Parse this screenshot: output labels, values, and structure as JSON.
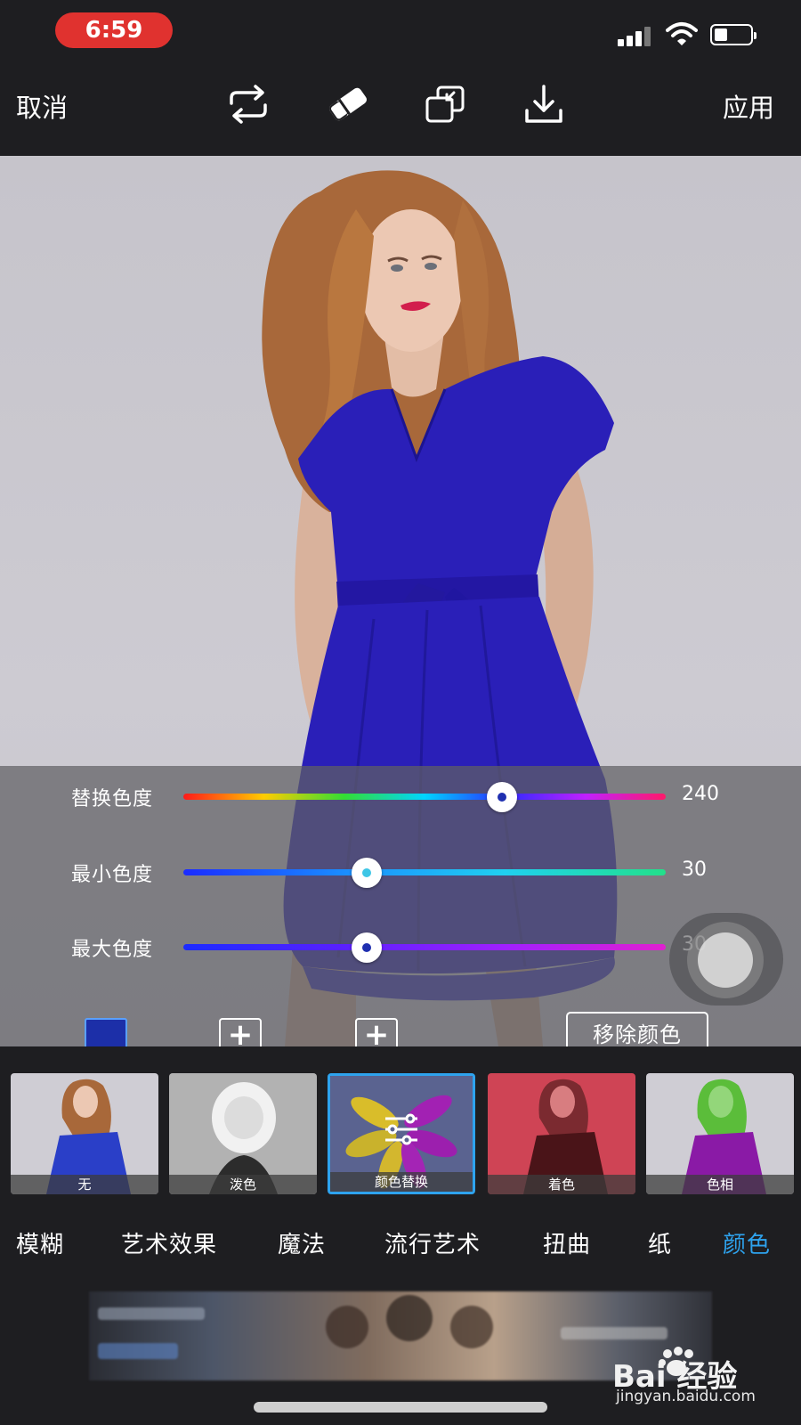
{
  "status_bar": {
    "time": "6:59"
  },
  "toolbar": {
    "cancel_label": "取消",
    "apply_label": "应用",
    "icons": [
      "repeat-icon",
      "eraser-icon",
      "layers-icon",
      "download-icon"
    ]
  },
  "sliders": [
    {
      "label": "替换色度",
      "value": "240",
      "position": 0.66,
      "dot_color": "#1f2fb0"
    },
    {
      "label": "最小色度",
      "value": "30",
      "position": 0.38,
      "dot_color": "#3ec6e6"
    },
    {
      "label": "最大色度",
      "value": "30",
      "position": 0.38,
      "dot_color": "#1f2fb0"
    }
  ],
  "colors": {
    "selected_swatch": "#1c2fa8",
    "accent": "#2ea3ee",
    "dress": "#2a1fb8"
  },
  "color_controls": {
    "add_label": "+",
    "remove_label": "移除颜色"
  },
  "effects": [
    {
      "label": "无"
    },
    {
      "label": "泼色"
    },
    {
      "label": "颜色替换",
      "selected": true
    },
    {
      "label": "着色"
    },
    {
      "label": "色相"
    }
  ],
  "categories": [
    {
      "label": "模糊"
    },
    {
      "label": "艺术效果"
    },
    {
      "label": "魔法"
    },
    {
      "label": "流行艺术"
    },
    {
      "label": "扭曲"
    },
    {
      "label": "纸"
    },
    {
      "label": "颜色",
      "active": true
    }
  ],
  "watermark": {
    "brand": "Bai 经验",
    "url": "jingyan.baidu.com"
  }
}
